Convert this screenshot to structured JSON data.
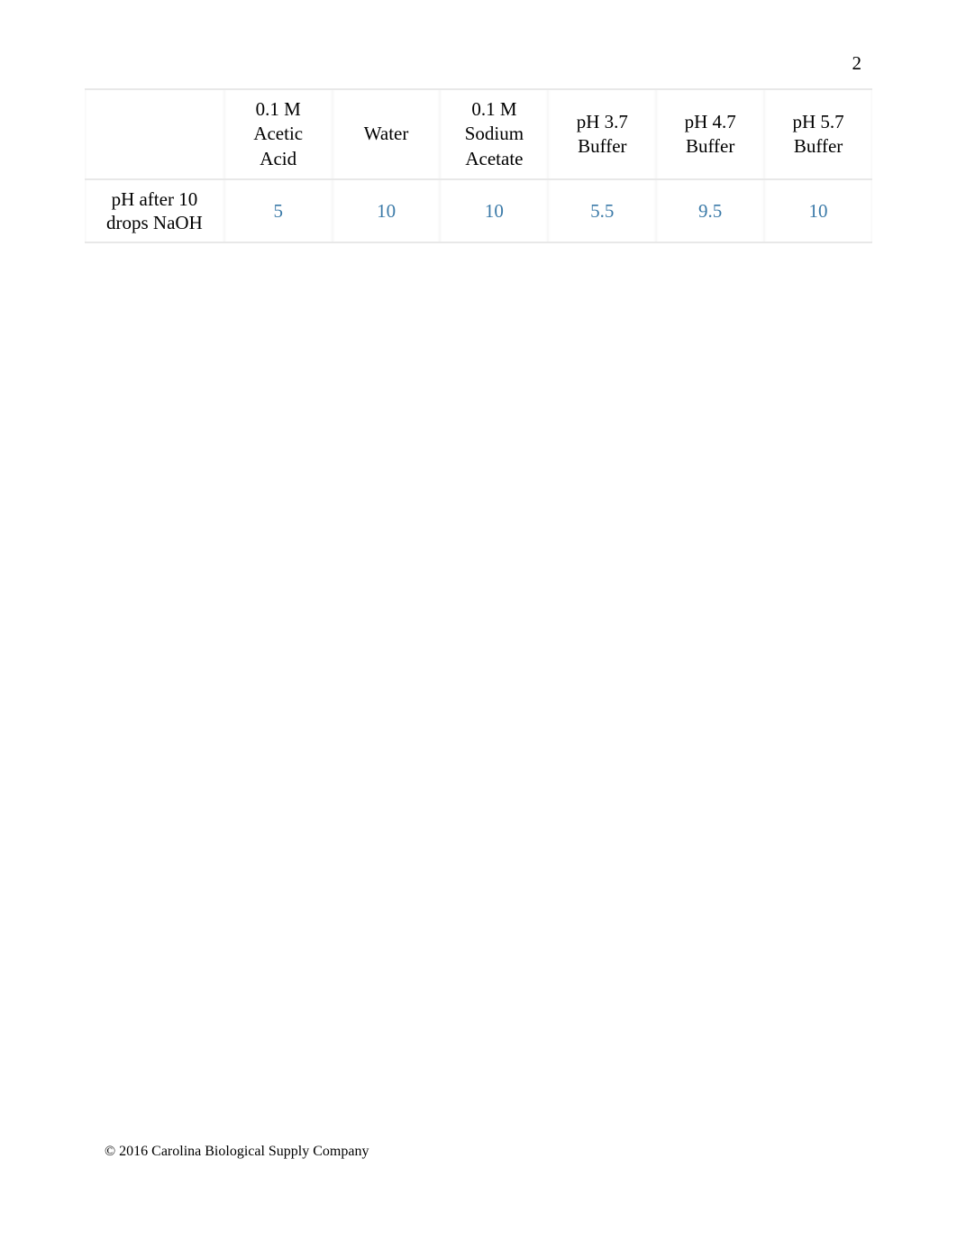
{
  "page_number": "2",
  "chart_data": {
    "type": "table",
    "title": "",
    "columns": [
      "",
      "0.1 M Acetic Acid",
      "Water",
      "0.1 M Sodium Acetate",
      "pH 3.7 Buffer",
      "pH 4.7 Buffer",
      "pH 5.7 Buffer"
    ],
    "rows": [
      {
        "label": "pH after 10 drops NaOH",
        "values": [
          "5",
          "10",
          "10",
          "5.5",
          "9.5",
          "10"
        ]
      }
    ]
  },
  "table": {
    "headers": {
      "col0": "",
      "col1": "0.1 M\nAcetic\nAcid",
      "col2": "Water",
      "col3": "0.1 M\nSodium\nAcetate",
      "col4": "pH 3.7\nBuffer",
      "col5": "pH 4.7\nBuffer",
      "col6": "pH 5.7\nBuffer"
    },
    "row0": {
      "label": "pH after 10\ndrops NaOH",
      "v1": "5",
      "v2": "10",
      "v3": "10",
      "v4": "5.5",
      "v5": "9.5",
      "v6": "10"
    }
  },
  "footer": "© 2016 Carolina Biological Supply Company"
}
